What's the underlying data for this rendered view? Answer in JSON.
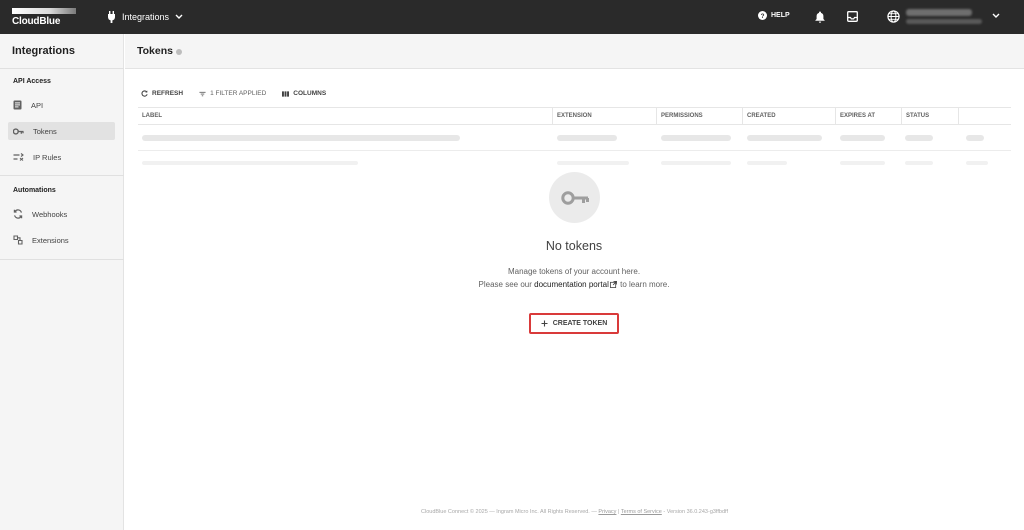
{
  "topbar": {
    "logo_text": "CloudBlue",
    "module_label": "Integrations",
    "help_label": "HELP"
  },
  "sidebar": {
    "title": "Integrations",
    "sections": [
      {
        "label": "API Access",
        "items": [
          {
            "label": "API",
            "icon": "book-icon"
          },
          {
            "label": "Tokens",
            "icon": "key-icon",
            "active": true
          },
          {
            "label": "IP Rules",
            "icon": "ip-rules-icon"
          }
        ]
      },
      {
        "label": "Automations",
        "items": [
          {
            "label": "Webhooks",
            "icon": "sync-icon"
          },
          {
            "label": "Extensions",
            "icon": "extension-icon"
          }
        ]
      }
    ]
  },
  "page": {
    "title": "Tokens"
  },
  "toolbar": {
    "refresh_label": "REFRESH",
    "filter_label": "1 FILTER APPLIED",
    "columns_label": "COLUMNS"
  },
  "table": {
    "columns": [
      "LABEL",
      "EXTENSION",
      "PERMISSIONS",
      "CREATED",
      "EXPIRES AT",
      "STATUS",
      ""
    ]
  },
  "empty_state": {
    "title": "No tokens",
    "line1": "Manage tokens of your account here.",
    "line2_before": "Please see our",
    "link_text": "documentation portal",
    "line2_after": "to learn more.",
    "button_label": "CREATE TOKEN"
  },
  "footer": {
    "text_before": "CloudBlue Connect © 2025 — Ingram Micro Inc. All Rights Reserved. —",
    "privacy": "Privacy",
    "separator": "|",
    "terms": "Terms of Service",
    "version": "- Version 36.0.243-g3ffbdff"
  },
  "colors": {
    "topbar_bg": "#2a2a2a",
    "sidebar_bg": "#f5f5f5",
    "highlight_border": "#d93a3a"
  }
}
